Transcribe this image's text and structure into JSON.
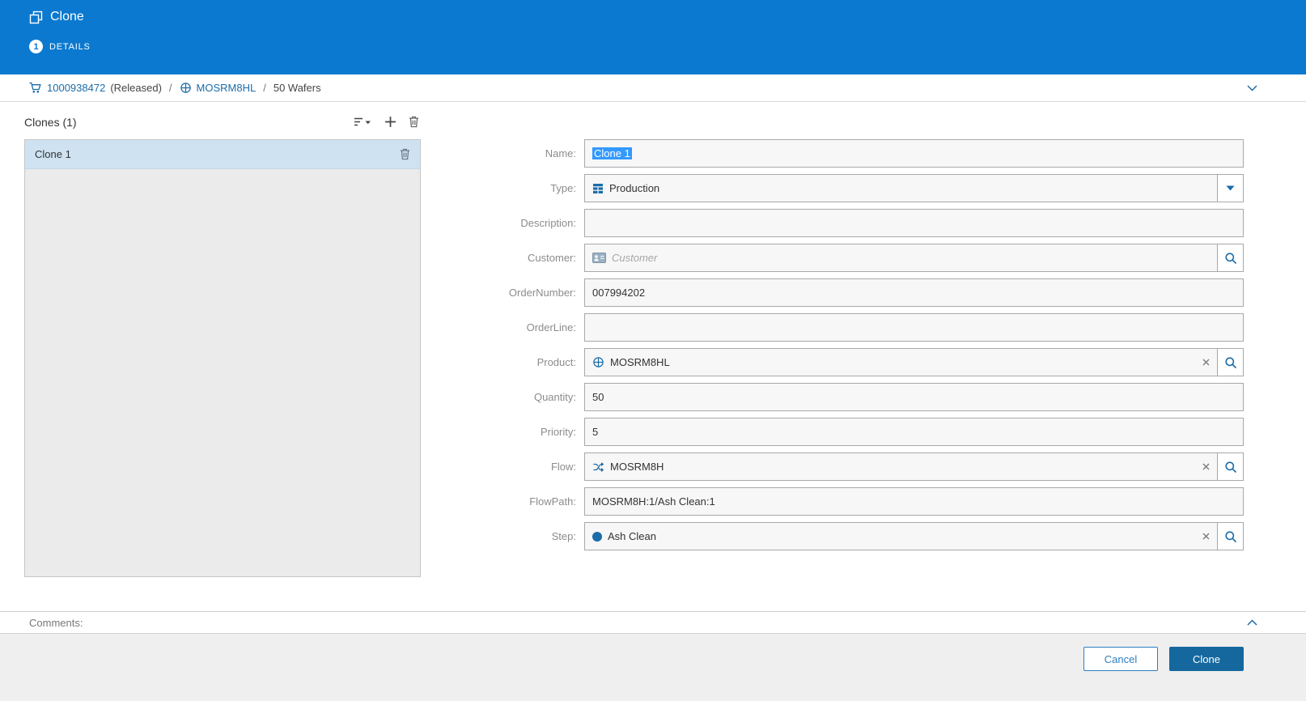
{
  "header": {
    "title": "Clone",
    "step_number": "1",
    "step_label": "DETAILS"
  },
  "breadcrumb": {
    "order_link": "1000938472",
    "order_status": "(Released)",
    "separator": "/",
    "product_link": "MOSRM8HL",
    "quantity_text": "50 Wafers"
  },
  "clones_panel": {
    "title": "Clones (1)",
    "items": [
      {
        "label": "Clone 1"
      }
    ]
  },
  "form": {
    "name": {
      "label": "Name:",
      "value": "Clone 1"
    },
    "type": {
      "label": "Type:",
      "value": "Production"
    },
    "description": {
      "label": "Description:",
      "value": ""
    },
    "customer": {
      "label": "Customer:",
      "value": "",
      "placeholder": "Customer"
    },
    "order_number": {
      "label": "OrderNumber:",
      "value": "007994202"
    },
    "order_line": {
      "label": "OrderLine:",
      "value": ""
    },
    "product": {
      "label": "Product:",
      "value": "MOSRM8HL"
    },
    "quantity": {
      "label": "Quantity:",
      "value": "50"
    },
    "priority": {
      "label": "Priority:",
      "value": "5"
    },
    "flow": {
      "label": "Flow:",
      "value": "MOSRM8H"
    },
    "flow_path": {
      "label": "FlowPath:",
      "value": "MOSRM8H:1/Ash Clean:1"
    },
    "step": {
      "label": "Step:",
      "value": "Ash Clean"
    }
  },
  "comments": {
    "label": "Comments:"
  },
  "footer": {
    "cancel_label": "Cancel",
    "clone_label": "Clone"
  },
  "icons": {
    "header": "clone-icon",
    "breadcrumb_order": "cart-icon",
    "breadcrumb_product": "wafer-icon",
    "panel_tools": [
      "filter-sort-icon",
      "add-icon",
      "delete-icon"
    ],
    "type_field": "table-grid-icon",
    "customer_field": "id-card-icon",
    "product_field": "wafer-icon",
    "flow_field": "flow-branch-icon",
    "step_field": "step-circle-icon",
    "lookup_buttons": "magnifier-icon",
    "clear_buttons": "x-icon",
    "collapse": "chevron-icon"
  },
  "colors": {
    "header_blue": "#0b79cf",
    "link_blue": "#1b6ca8",
    "primary_button_blue": "#15689e",
    "selected_row_blue": "#cfe2f2",
    "selection_highlight": "#3399ff",
    "input_background": "#f7f7f7",
    "footer_gray": "#efefef"
  }
}
